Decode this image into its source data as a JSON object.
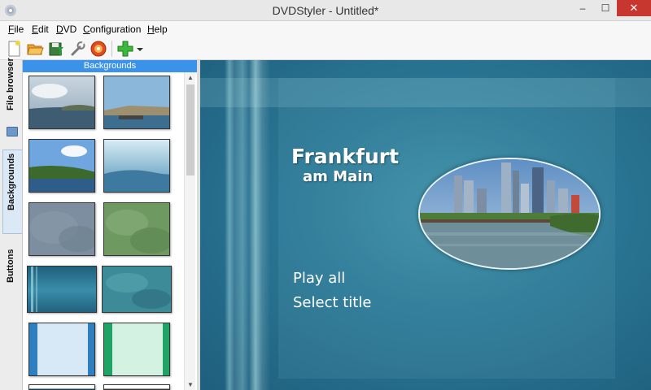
{
  "window": {
    "title": "DVDStyler - Untitled*",
    "min_glyph": "–",
    "max_glyph": "☐",
    "close_glyph": "✕"
  },
  "menu": [
    {
      "label": "File",
      "mnemonic": "F",
      "rest": "ile"
    },
    {
      "label": "Edit",
      "mnemonic": "E",
      "rest": "dit"
    },
    {
      "label": "DVD",
      "mnemonic": "D",
      "rest": "VD"
    },
    {
      "label": "Configuration",
      "mnemonic": "C",
      "rest": "onfiguration"
    },
    {
      "label": "Help",
      "mnemonic": "H",
      "rest": "elp"
    }
  ],
  "toolbar": {
    "icons": [
      "new-icon",
      "open-icon",
      "save-icon",
      "settings-wrench-icon",
      "burn-disc-icon",
      "add-icon",
      "dropdown-arrow-icon"
    ]
  },
  "side_tabs": [
    {
      "label": "File browser",
      "active": false
    },
    {
      "label": "Backgrounds",
      "active": true
    },
    {
      "label": "Buttons",
      "active": false
    }
  ],
  "panel": {
    "header": "Backgrounds"
  },
  "canvas": {
    "title_line1": "Frankfurt",
    "title_line2": "am Main",
    "buttons": [
      "Play all",
      "Select title"
    ]
  },
  "colors": {
    "panel_header": "#3a93e8",
    "close_button": "#c7372f",
    "canvas_base": "#2b7896"
  }
}
